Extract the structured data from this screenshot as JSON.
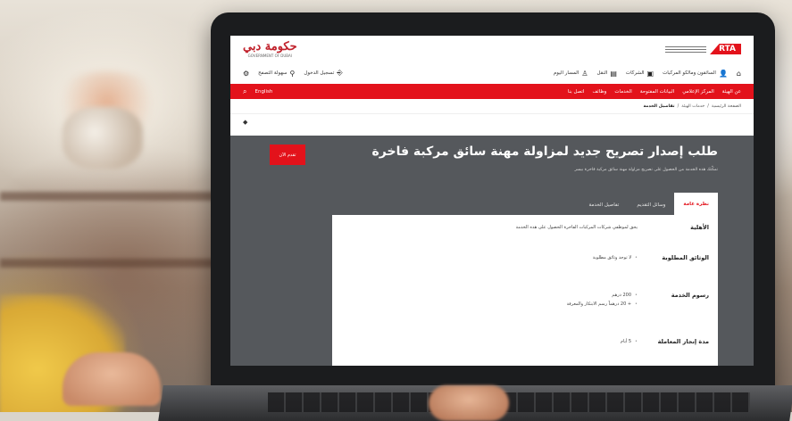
{
  "portal": {
    "rta_badge": "RTA"
  },
  "header_nav": [
    {
      "icon": "home-icon",
      "label": ""
    },
    {
      "icon": "user-icon",
      "label": "السائقون ومالكو المركبات"
    },
    {
      "icon": "building-icon",
      "label": "الشركات"
    },
    {
      "icon": "car-icon",
      "label": "النقل"
    },
    {
      "icon": "person-icon",
      "label": "المسار اليوم"
    }
  ],
  "header_tools": {
    "login_label": "تسجيل الدخول",
    "accessibility_label": "سهولة التصفح"
  },
  "red_nav": {
    "items": [
      "عن الهيئة",
      "المركز الإعلامي",
      "البيانات المفتوحة",
      "الخدمات",
      "وظائف",
      "اتصل بنا"
    ],
    "language": "English"
  },
  "breadcrumb": {
    "items": [
      "الصفحة الرئيسية",
      "خدمات الهيئة"
    ],
    "current": "تفاصيل الخدمة"
  },
  "service": {
    "title": "طلب إصدار تصريح جديد لمزاولة مهنة سائق مركبة فاخرة",
    "description": "تمكّنك هذه الخدمة من الحصول على تصريح مزاولة مهنة سائق مركبة فاخرة بيسر",
    "apply_label": "تقدم الآن"
  },
  "tabs": [
    "نظرة عامة",
    "وسائل التقديم",
    "تفاصيل الخدمة"
  ],
  "details": {
    "eligibility_label": "الأهلية",
    "eligibility_value": "يحق لموظفي شركات المركبات الفاخرة الحصول على هذه الخدمة",
    "documents_label": "الوثائق المطلوبة",
    "documents": [
      "لا توجد وثائق مطلوبة"
    ],
    "fees_label": "رسوم الخدمة",
    "fees": [
      "200 درهم",
      "+ 20 درهماً رسم الابتكار والمعرفة"
    ],
    "duration_label": "مدة إنجاز المعاملة",
    "duration": [
      "5 أيام"
    ]
  }
}
